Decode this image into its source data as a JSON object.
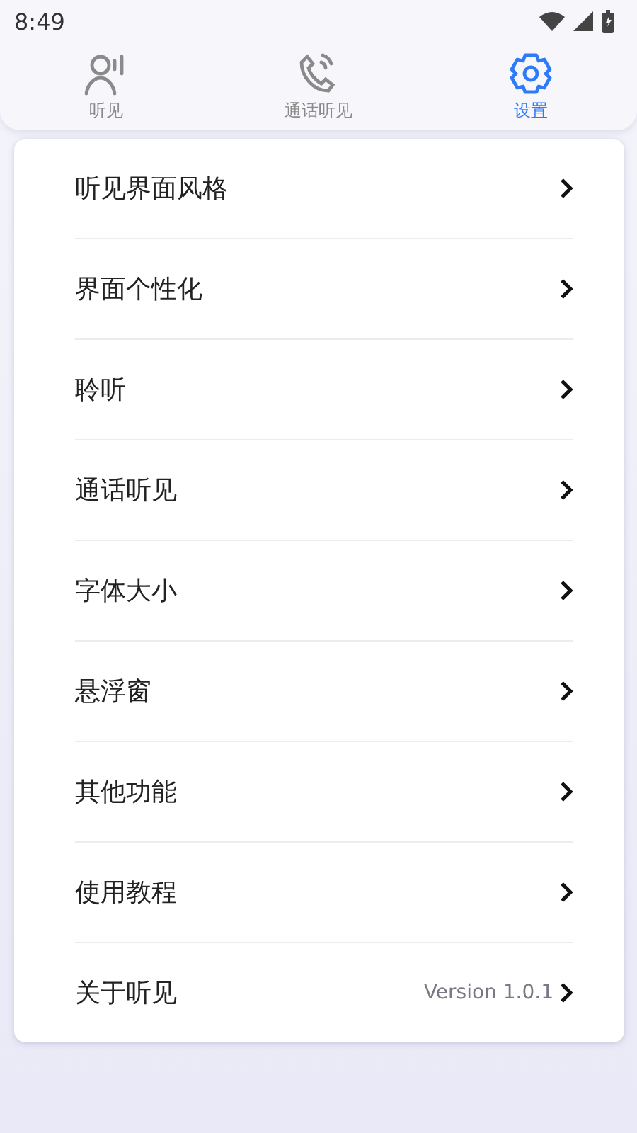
{
  "status_bar": {
    "time": "8:49"
  },
  "tabs": [
    {
      "kind": "listen",
      "label": "听见",
      "selected": false
    },
    {
      "kind": "call",
      "label": "通话听见",
      "selected": false
    },
    {
      "kind": "settings",
      "label": "设置",
      "selected": true
    }
  ],
  "settings": [
    {
      "label": "听见界面风格"
    },
    {
      "label": "界面个性化"
    },
    {
      "label": "聆听"
    },
    {
      "label": "通话听见"
    },
    {
      "label": "字体大小"
    },
    {
      "label": "悬浮窗"
    },
    {
      "label": "其他功能"
    },
    {
      "label": "使用教程"
    },
    {
      "label": "关于听见",
      "value": "Version 1.0.1"
    }
  ]
}
